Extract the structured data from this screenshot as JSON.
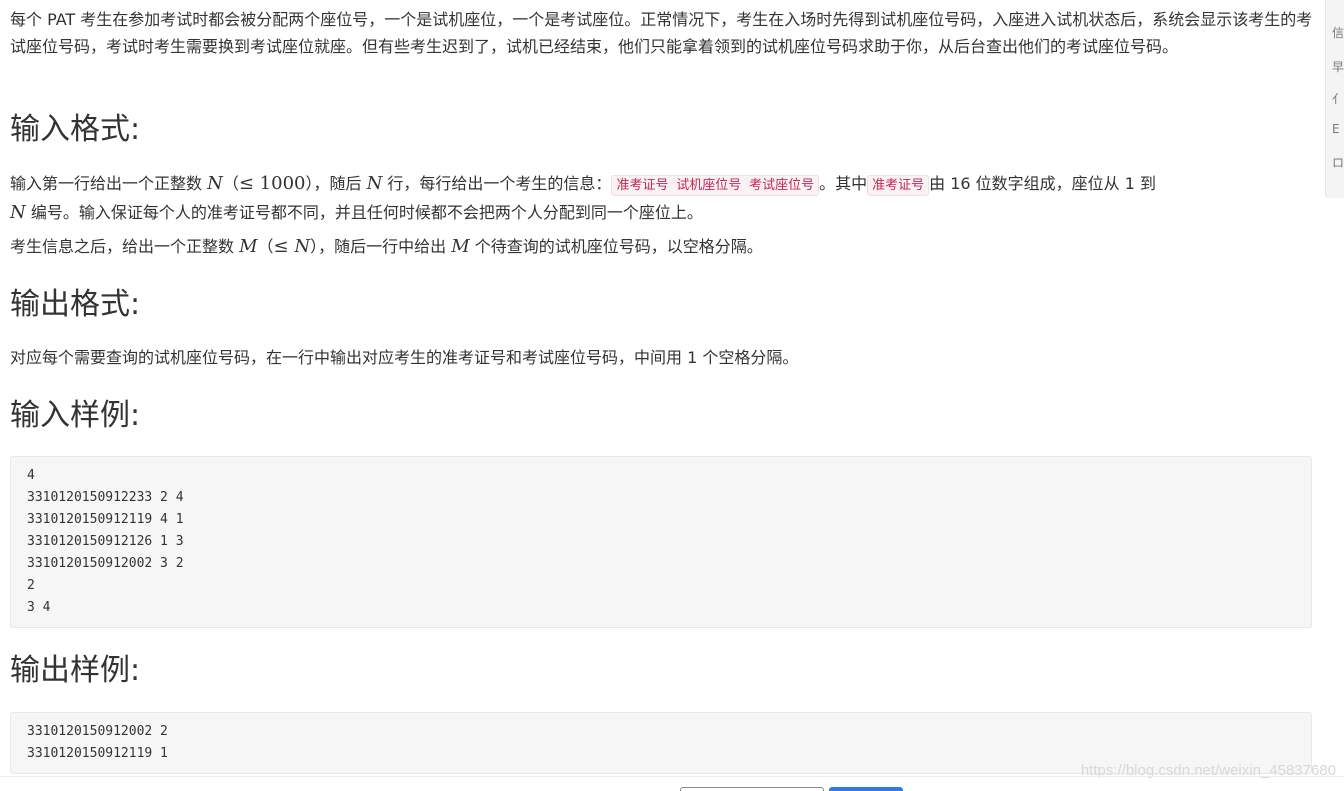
{
  "intro": {
    "text": "每个 PAT 考生在参加考试时都会被分配两个座位号，一个是试机座位，一个是考试座位。正常情况下，考生在入场时先得到试机座位号码，入座进入试机状态后，系统会显示该考生的考试座位号码，考试时考生需要换到考试座位就座。但有些考生迟到了，试机已经结束，他们只能拿着领到的试机座位号码求助于你，从后台查出他们的考试座位号码。"
  },
  "input_format": {
    "heading": "输入格式:",
    "p1_a": "输入第一行给出一个正整数 ",
    "p1_N": "N",
    "p1_paren_open": "（",
    "p1_le": "≤ 1000",
    "p1_paren_close": "）",
    "p1_b": "，随后 ",
    "p1_N2": "N",
    "p1_c": " 行，每行给出一个考生的信息：",
    "p1_code": "准考证号 试机座位号 考试座位号",
    "p1_d": "。其中",
    "p1_code2": "准考证号",
    "p1_e": "由 16 位数字组成，座位从 1 到 ",
    "p1_N3": "N",
    "p1_f": " 编号。输入保证每个人的准考证号都不同，并且任何时候都不会把两个人分配到同一个座位上。",
    "p2_a": "考生信息之后，给出一个正整数 ",
    "p2_M": "M",
    "p2_paren_open": "（",
    "p2_le": "≤ ",
    "p2_N": "N",
    "p2_paren_close": "）",
    "p2_b": "，随后一行中给出 ",
    "p2_M2": "M",
    "p2_c": " 个待查询的试机座位号码，以空格分隔。"
  },
  "output_format": {
    "heading": "输出格式:",
    "text": "对应每个需要查询的试机座位号码，在一行中输出对应考生的准考证号和考试座位号码，中间用 1 个空格分隔。"
  },
  "sample_input": {
    "heading": "输入样例:",
    "lines": [
      "4",
      "3310120150912233 2 4",
      "3310120150912119 4 1",
      "3310120150912126 1 3",
      "3310120150912002 3 2",
      "2",
      "3 4"
    ]
  },
  "sample_output": {
    "heading": "输出样例:",
    "lines": [
      "3310120150912002 2",
      "3310120150912119 1"
    ]
  },
  "side_strip": {
    "chars": [
      "信",
      "早",
      "亻",
      "E",
      "ロ"
    ]
  },
  "watermark": "https://blog.csdn.net/weixin_45837680",
  "colors": {
    "code_text": "#c7254e",
    "code_bg": "#f9f2f4",
    "pre_bg": "#f6f6f6",
    "primary_button": "#2f7de1"
  }
}
